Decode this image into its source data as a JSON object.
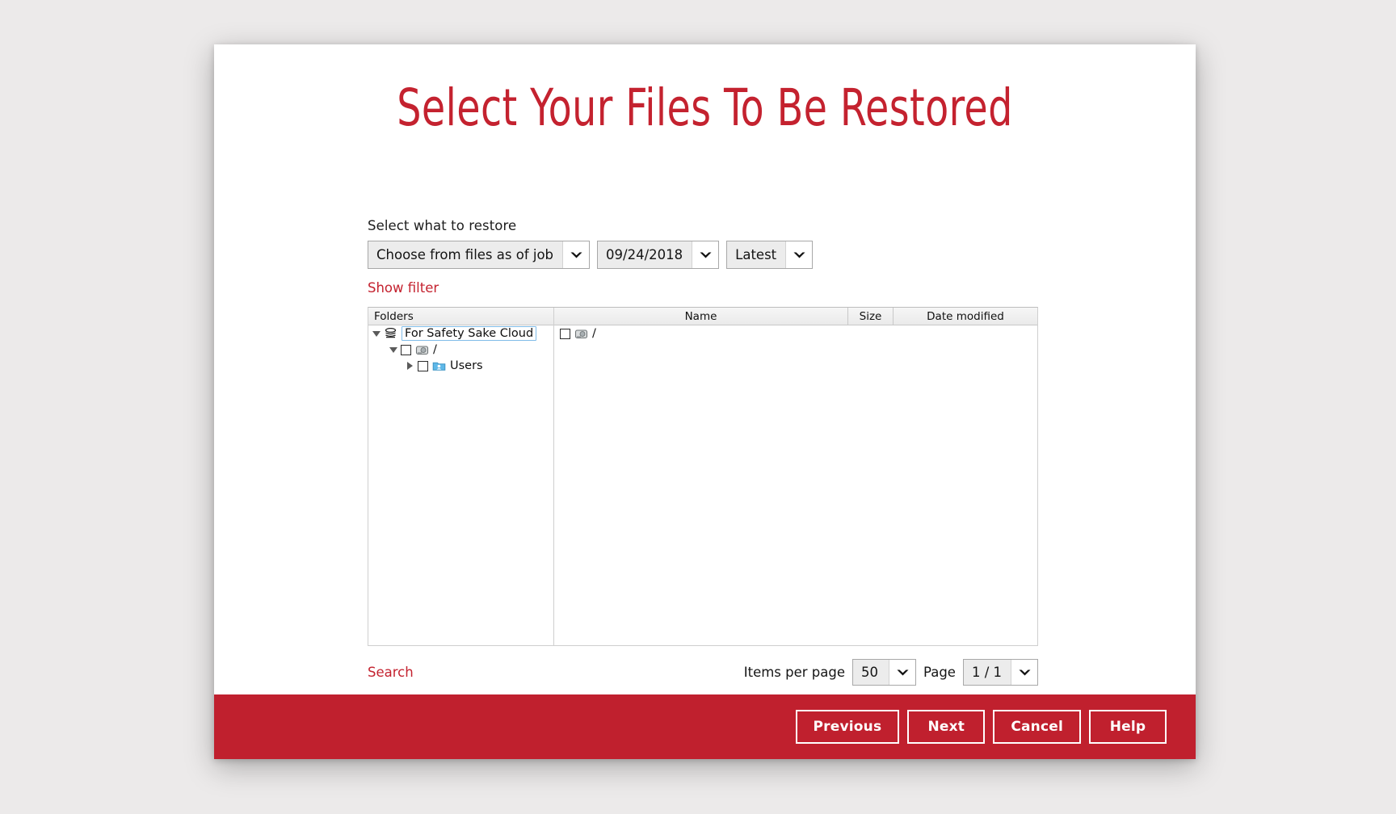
{
  "dialog": {
    "title": "Select Your Files To Be Restored"
  },
  "form": {
    "label": "Select what to restore",
    "source_select": {
      "value": "Choose from files as of job",
      "icon": "chevron-down-icon"
    },
    "date_select": {
      "value": "09/24/2018",
      "icon": "chevron-down-icon"
    },
    "version_select": {
      "value": "Latest",
      "icon": "chevron-down-icon"
    },
    "show_filter_link": "Show filter"
  },
  "browser": {
    "tree_header": "Folders",
    "columns": [
      "Name",
      "Size",
      "Date modified"
    ],
    "tree": [
      {
        "label": "For Safety Sake Cloud",
        "icon": "cloud-stack-icon",
        "expander": "triangle-down",
        "has_checkbox": false,
        "selected": true,
        "indent": 0
      },
      {
        "label": "/",
        "icon": "hard-drive-icon",
        "expander": "triangle-down",
        "has_checkbox": true,
        "selected": false,
        "indent": 1
      },
      {
        "label": "Users",
        "icon": "users-folder-icon",
        "expander": "triangle-right",
        "has_checkbox": true,
        "selected": false,
        "indent": 2
      }
    ],
    "files": [
      {
        "name": "/",
        "icon": "hard-drive-icon",
        "size": "",
        "date_modified": "",
        "checked": false
      }
    ]
  },
  "pagination": {
    "search_link": "Search",
    "items_per_page_label": "Items per page",
    "items_per_page_value": "50",
    "page_label": "Page",
    "page_value": "1 / 1"
  },
  "actions": {
    "previous": "Previous",
    "next": "Next",
    "cancel": "Cancel",
    "help": "Help"
  },
  "colors": {
    "brand_red": "#c0202e",
    "title_red": "#c4222f",
    "link_red": "#c4222f"
  }
}
